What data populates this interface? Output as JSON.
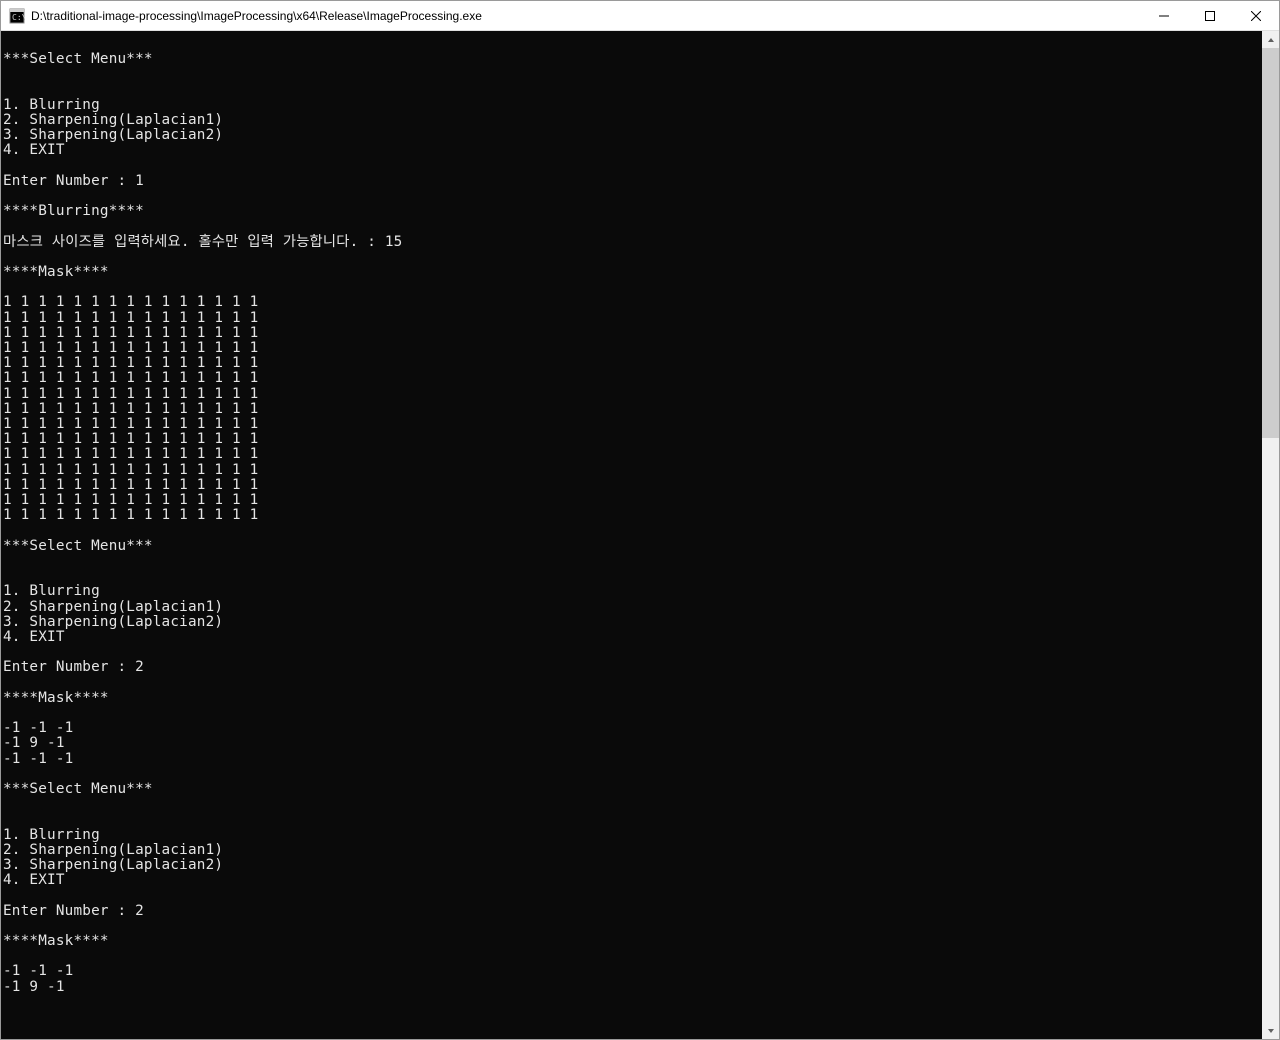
{
  "window": {
    "title": "D:\\traditional-image-processing\\ImageProcessing\\x64\\Release\\ImageProcessing.exe"
  },
  "console": {
    "lines": [
      "",
      "***Select Menu***",
      "",
      "",
      "1. Blurring",
      "2. Sharpening(Laplacian1)",
      "3. Sharpening(Laplacian2)",
      "4. EXIT",
      "",
      "Enter Number : 1",
      "",
      "****Blurring****",
      "",
      "마스크 사이즈를 입력하세요. 홀수만 입력 가능합니다. : 15",
      "",
      "****Mask****",
      "",
      "1 1 1 1 1 1 1 1 1 1 1 1 1 1 1",
      "1 1 1 1 1 1 1 1 1 1 1 1 1 1 1",
      "1 1 1 1 1 1 1 1 1 1 1 1 1 1 1",
      "1 1 1 1 1 1 1 1 1 1 1 1 1 1 1",
      "1 1 1 1 1 1 1 1 1 1 1 1 1 1 1",
      "1 1 1 1 1 1 1 1 1 1 1 1 1 1 1",
      "1 1 1 1 1 1 1 1 1 1 1 1 1 1 1",
      "1 1 1 1 1 1 1 1 1 1 1 1 1 1 1",
      "1 1 1 1 1 1 1 1 1 1 1 1 1 1 1",
      "1 1 1 1 1 1 1 1 1 1 1 1 1 1 1",
      "1 1 1 1 1 1 1 1 1 1 1 1 1 1 1",
      "1 1 1 1 1 1 1 1 1 1 1 1 1 1 1",
      "1 1 1 1 1 1 1 1 1 1 1 1 1 1 1",
      "1 1 1 1 1 1 1 1 1 1 1 1 1 1 1",
      "1 1 1 1 1 1 1 1 1 1 1 1 1 1 1",
      "",
      "***Select Menu***",
      "",
      "",
      "1. Blurring",
      "2. Sharpening(Laplacian1)",
      "3. Sharpening(Laplacian2)",
      "4. EXIT",
      "",
      "Enter Number : 2",
      "",
      "****Mask****",
      "",
      "-1 -1 -1",
      "-1 9 -1",
      "-1 -1 -1",
      "",
      "***Select Menu***",
      "",
      "",
      "1. Blurring",
      "2. Sharpening(Laplacian1)",
      "3. Sharpening(Laplacian2)",
      "4. EXIT",
      "",
      "Enter Number : 2",
      "",
      "****Mask****",
      "",
      "-1 -1 -1",
      "-1 9 -1"
    ]
  }
}
